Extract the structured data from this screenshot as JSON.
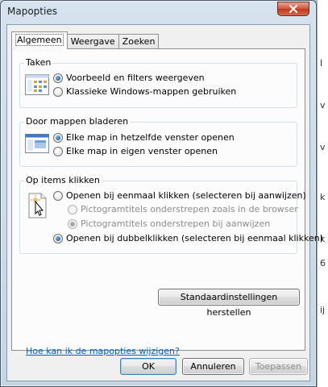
{
  "window": {
    "title": "Mapopties"
  },
  "tabs": [
    {
      "label": "Algemeen",
      "active": true
    },
    {
      "label": "Weergave",
      "active": false
    },
    {
      "label": "Zoeken",
      "active": false
    }
  ],
  "groups": {
    "taken": {
      "title": "Taken",
      "options": [
        {
          "label": "Voorbeeld en filters weergeven",
          "checked": true
        },
        {
          "label": "Klassieke Windows-mappen gebruiken",
          "checked": false
        }
      ]
    },
    "browse": {
      "title": "Door mappen bladeren",
      "options": [
        {
          "label": "Elke map in hetzelfde venster openen",
          "checked": true
        },
        {
          "label": "Elke map in eigen venster openen",
          "checked": false
        }
      ]
    },
    "click": {
      "title": "Op items klikken",
      "options": [
        {
          "label": "Openen bij eenmaal klikken (selecteren bij aanwijzen)",
          "checked": false
        },
        {
          "label": "Pictogramtitels onderstrepen zoals in de browser",
          "checked": false,
          "disabled": true
        },
        {
          "label": "Pictogramtitels onderstrepen bij aanwijzen",
          "checked": true,
          "disabled": true
        },
        {
          "label": "Openen bij dubbelklikken (selecteren bij eenmaal klikken)",
          "checked": true
        }
      ]
    }
  },
  "restore_button": "Standaardinstellingen herstellen",
  "help_link": "Hoe kan ik de mapopties wijzigen?",
  "buttons": {
    "ok": "OK",
    "cancel": "Annuleren",
    "apply": "Toepassen"
  },
  "background_fragments": [
    "I",
    "v",
    "v",
    "k",
    "k",
    "6",
    "ij"
  ],
  "colors": {
    "link": "#0066cc",
    "accent": "#1c5ca8",
    "close": "#c1361b"
  }
}
